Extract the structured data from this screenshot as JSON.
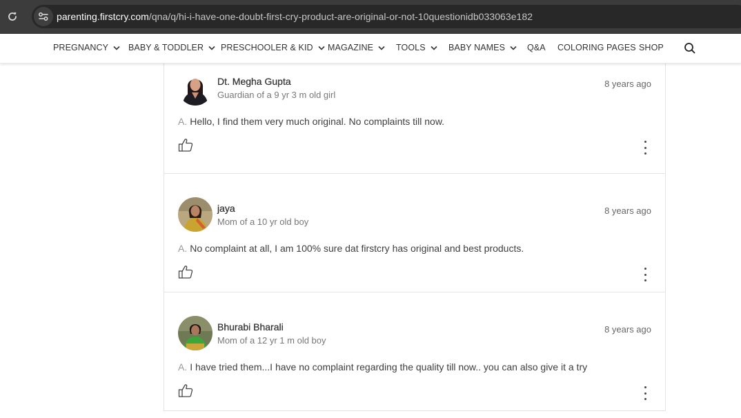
{
  "browser": {
    "url_host": "parenting.firstcry.com",
    "url_path": "/qna/q/hi-i-have-one-doubt-first-cry-product-are-original-or-not-10questionidb033063e182"
  },
  "nav": {
    "items": [
      {
        "label": "PREGNANCY",
        "dropdown": true
      },
      {
        "label": "BABY & TODDLER",
        "dropdown": true
      },
      {
        "label": "PRESCHOOLER & KID",
        "dropdown": true
      },
      {
        "label": "MAGAZINE",
        "dropdown": true
      },
      {
        "label": "TOOLS",
        "dropdown": true
      },
      {
        "label": "BABY NAMES",
        "dropdown": true
      },
      {
        "label": "Q&A",
        "dropdown": false
      },
      {
        "label": "COLORING PAGES",
        "dropdown": false
      },
      {
        "label": "SHOP",
        "dropdown": false
      }
    ]
  },
  "answers": [
    {
      "author": "Dt. Megha Gupta",
      "relation": "Guardian of a 9 yr 3 m old girl",
      "time": "8 years ago",
      "prefix": "A.",
      "text": "Hello, I find them very much original. No complaints till now."
    },
    {
      "author": "jaya",
      "relation": "Mom of a 10 yr old boy",
      "time": "8 years ago",
      "prefix": "A.",
      "text": "No complaint at all, I am 100% sure dat firstcry has original and best products."
    },
    {
      "author": "Bhurabi Bharali",
      "relation": "Mom of a 12 yr 1 m old boy",
      "time": "8 years ago",
      "prefix": "A.",
      "text": "I have tried them...I have no complaint regarding the quality till now.. you can also give it a try"
    }
  ],
  "colors": {
    "chrome_bg": "#3c3c3c",
    "omnibox_bg": "#282828",
    "nav_text": "#333333",
    "muted_text": "#777777",
    "border": "#e3e3e3"
  },
  "icons": {
    "reload": "reload-icon",
    "site_info": "site-settings-icon",
    "search": "search-icon",
    "like": "thumbs-up-icon",
    "more": "more-vertical-icon",
    "dropdown": "chevron-down-icon"
  }
}
